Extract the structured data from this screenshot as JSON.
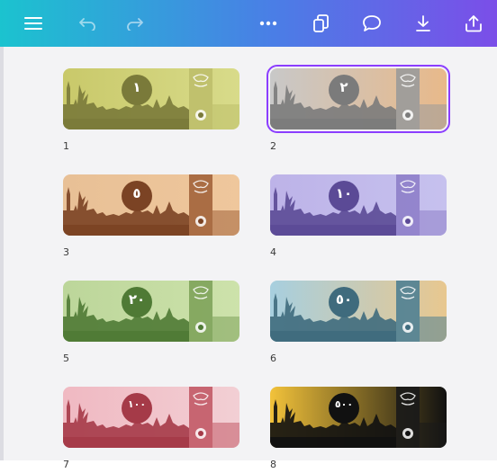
{
  "toolbar": {
    "icons": [
      "menu-icon",
      "undo-icon",
      "redo-icon",
      "more-icon",
      "duplicate-icon",
      "comment-icon",
      "download-icon",
      "share-icon"
    ]
  },
  "pages": [
    {
      "label": "1",
      "denomination": "١",
      "bg_start": "#c9c96a",
      "bg_end": "#d8db8a",
      "side": "#bebf6a",
      "dark": "#7a7a3a",
      "circle": "#7a7a3a",
      "selected": false
    },
    {
      "label": "2",
      "denomination": "٢",
      "bg_start": "#c8c8c8",
      "bg_end": "#e8b98a",
      "side": "#9a9a9a",
      "dark": "#7b7b7b",
      "circle": "#7b7b7b",
      "selected": true
    },
    {
      "label": "3",
      "denomination": "٥",
      "bg_start": "#e8c096",
      "bg_end": "#efc79c",
      "side": "#a2633b",
      "dark": "#7b4324",
      "circle": "#7b4324",
      "selected": false
    },
    {
      "label": "4",
      "denomination": "١٠",
      "bg_start": "#bdb3e8",
      "bg_end": "#c6c1ee",
      "side": "#8e7ec9",
      "dark": "#5b4a96",
      "circle": "#5b4a96",
      "selected": false
    },
    {
      "label": "5",
      "denomination": "٢٠",
      "bg_start": "#bcd69a",
      "bg_end": "#cde2ab",
      "side": "#7ea35a",
      "dark": "#4f7a35",
      "circle": "#4f7a35",
      "selected": false
    },
    {
      "label": "6",
      "denomination": "٥٠",
      "bg_start": "#a7cfdf",
      "bg_end": "#e8c78f",
      "side": "#4f7f92",
      "dark": "#3f6b7d",
      "circle": "#3f6b7d",
      "selected": false
    },
    {
      "label": "7",
      "denomination": "١٠٠",
      "bg_start": "#f0b9c2",
      "bg_end": "#f2cfd4",
      "side": "#c25a66",
      "dark": "#a53a48",
      "circle": "#a53a48",
      "selected": false
    },
    {
      "label": "8",
      "denomination": "٥٠٠",
      "bg_start": "#f2c23a",
      "bg_end": "#111111",
      "side": "#1a1a1a",
      "dark": "#111111",
      "circle": "#111111",
      "selected": false
    }
  ]
}
